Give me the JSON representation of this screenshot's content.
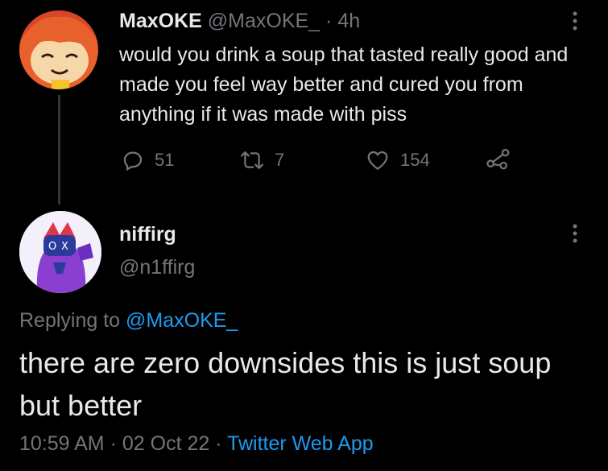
{
  "tweet": {
    "author_name": "MaxOKE",
    "author_handle": "@MaxOKE_",
    "separator": "·",
    "age": "4h",
    "text": "would you drink a soup that tasted really good and made you feel way better and cured you from anything if it was made with piss",
    "reply_count": "51",
    "retweet_count": "7",
    "like_count": "154"
  },
  "reply": {
    "author_name": "niffirg",
    "author_handle": "@n1ffirg",
    "replying_prefix": "Replying to",
    "replying_handle": "@MaxOKE_",
    "text": "there are zero downsides this is just soup but better",
    "time": "10:59 AM",
    "date": "02 Oct 22",
    "separator": "·",
    "source": "Twitter Web App"
  },
  "icons": [
    "reply-icon",
    "retweet-icon",
    "like-icon",
    "share-icon",
    "more-icon"
  ],
  "colors": {
    "background": "#000000",
    "text": "#e7e9ea",
    "muted": "#71767b",
    "link": "#1d9bf0"
  }
}
